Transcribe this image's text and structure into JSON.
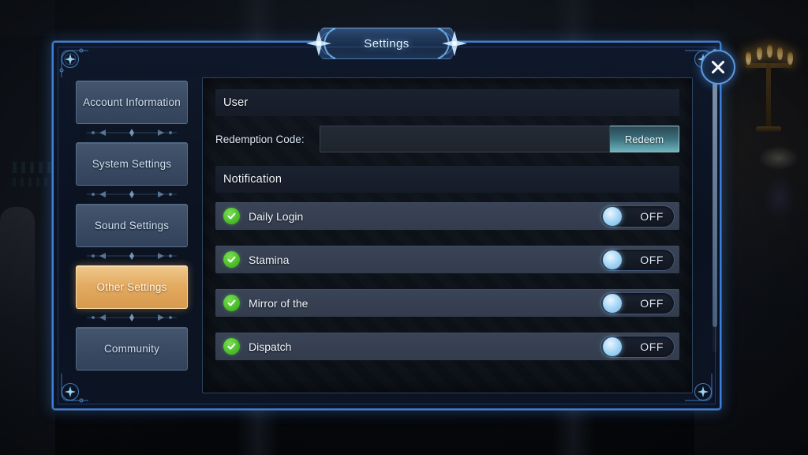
{
  "window": {
    "title": "Settings",
    "close_label": "✕"
  },
  "sidebar": {
    "items": [
      {
        "label": "Account Information",
        "active": false
      },
      {
        "label": "System Settings",
        "active": false
      },
      {
        "label": "Sound Settings",
        "active": false
      },
      {
        "label": "Other Settings",
        "active": true
      },
      {
        "label": "Community",
        "active": false
      }
    ]
  },
  "content": {
    "user_section": {
      "header": "User",
      "redemption_label": "Redemption Code:",
      "redemption_value": "",
      "redemption_placeholder": "",
      "redeem_button": "Redeem"
    },
    "notification_section": {
      "header": "Notification",
      "rows": [
        {
          "label": "Daily Login",
          "toggle": "OFF",
          "enabled_icon": "check-circle-icon"
        },
        {
          "label": "Stamina",
          "toggle": "OFF",
          "enabled_icon": "check-circle-icon"
        },
        {
          "label": "Mirror of the",
          "toggle": "OFF",
          "enabled_icon": "check-circle-icon"
        },
        {
          "label": "Dispatch",
          "toggle": "OFF",
          "enabled_icon": "check-circle-icon"
        }
      ]
    }
  },
  "colors": {
    "panel_border": "#3f7fd6",
    "active_item": "#e3ab62",
    "toggle_knob": "#9fd2f4",
    "check_green": "#4cbf2a",
    "redeem_teal": "#6fb3bb"
  }
}
